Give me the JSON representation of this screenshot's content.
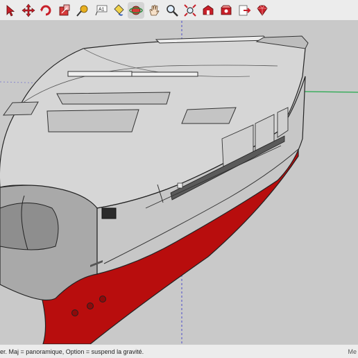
{
  "toolbar": {
    "tools": [
      {
        "name": "select-tool",
        "icon": "select-arrow-icon"
      },
      {
        "name": "move-tool",
        "icon": "move-arrows-icon"
      },
      {
        "name": "rotate-tool",
        "icon": "rotate-icon"
      },
      {
        "name": "scale-tool",
        "icon": "scale-icon"
      },
      {
        "name": "tape-measure-tool",
        "icon": "tape-measure-icon"
      },
      {
        "name": "text-tool",
        "icon": "text-icon",
        "label": "A1"
      },
      {
        "name": "paint-bucket-tool",
        "icon": "paint-bucket-icon"
      },
      {
        "name": "orbit-tool",
        "icon": "orbit-icon",
        "active": true
      },
      {
        "name": "pan-tool",
        "icon": "hand-icon"
      },
      {
        "name": "zoom-tool",
        "icon": "magnifier-icon"
      },
      {
        "name": "zoom-extents-tool",
        "icon": "zoom-extents-icon"
      },
      {
        "name": "warehouse-tool",
        "icon": "warehouse-icon"
      },
      {
        "name": "extension-warehouse-tool",
        "icon": "extension-warehouse-icon"
      },
      {
        "name": "send-to-layout-tool",
        "icon": "send-to-layout-icon"
      },
      {
        "name": "extension-manager-tool",
        "icon": "ruby-gem-icon"
      }
    ]
  },
  "status": {
    "text": "er. Maj = panoramique, Option =  suspend la gravité.",
    "right": "Me"
  },
  "colors": {
    "hull_red": "#b80d0d",
    "hull_gray": "#d6d6d6",
    "background": "#c9c9c9",
    "icon_red": "#c8202a"
  }
}
